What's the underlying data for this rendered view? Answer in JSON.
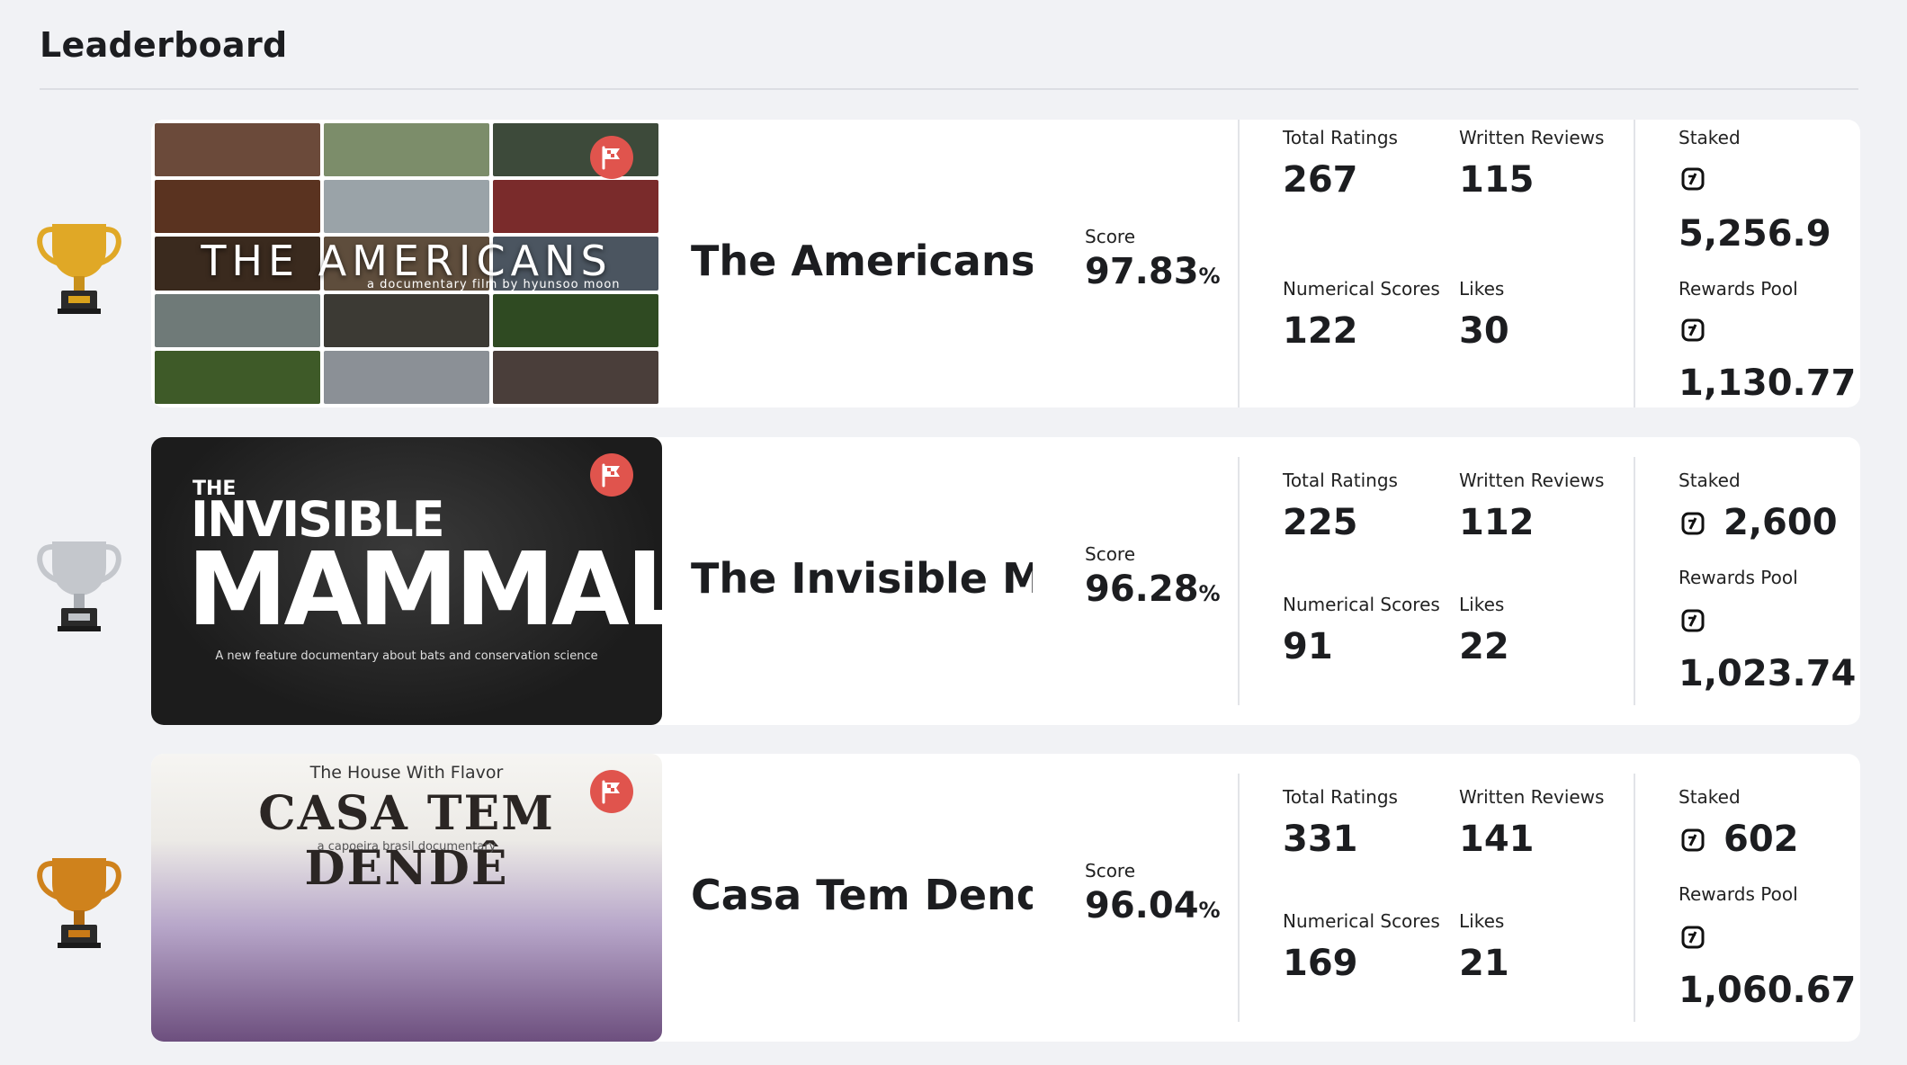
{
  "page": {
    "title": "Leaderboard"
  },
  "labels": {
    "score": "Score",
    "percent": "%",
    "total_ratings": "Total Ratings",
    "written_reviews": "Written Reviews",
    "numerical_scores": "Numerical Scores",
    "likes": "Likes",
    "staked": "Staked",
    "rewards_pool": "Rewards Pool"
  },
  "colors": {
    "background": "#f1f2f5",
    "card": "#ffffff",
    "flag_badge": "#e0544d",
    "gold": "#d9a21b",
    "silver": "#bfc3c8",
    "bronze": "#c97a17"
  },
  "entries": [
    {
      "rank_icon": "gold-trophy-icon",
      "title": "The Americans",
      "poster_text": "THE AMERICANS",
      "poster_subtitle": "a documentary film by hyunsoo moon",
      "score": "97.83",
      "total_ratings": "267",
      "written_reviews": "115",
      "numerical_scores": "122",
      "likes": "30",
      "staked": "5,256.9",
      "rewards_pool": "1,130.77"
    },
    {
      "rank_icon": "silver-trophy-icon",
      "title": "The Invisible M...",
      "poster_the": "THE",
      "poster_line1": "INVISIBLE",
      "poster_line2": "MAMMAL",
      "poster_tagline": "A new feature documentary about bats and conservation science",
      "score": "96.28",
      "total_ratings": "225",
      "written_reviews": "112",
      "numerical_scores": "91",
      "likes": "22",
      "staked": "2,600",
      "rewards_pool": "1,023.74"
    },
    {
      "rank_icon": "bronze-trophy-icon",
      "title": "Casa Tem Dend...",
      "poster_top": "The House With Flavor",
      "poster_main": "CASA TEM DENDÊ",
      "poster_sub": "a capoeira brasil documentary",
      "score": "96.04",
      "total_ratings": "331",
      "written_reviews": "141",
      "numerical_scores": "169",
      "likes": "21",
      "staked": "602",
      "rewards_pool": "1,060.67"
    }
  ]
}
